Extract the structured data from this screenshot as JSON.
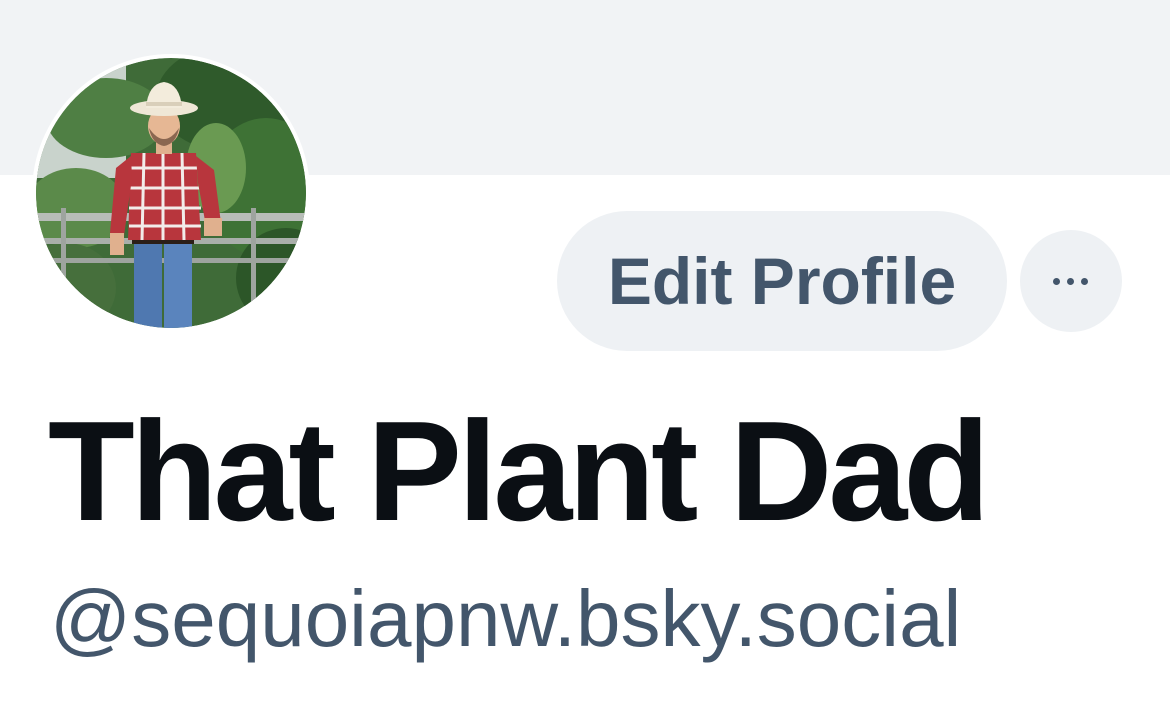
{
  "profile": {
    "display_name": "That Plant Dad",
    "handle": "@sequoiapnw.bsky.social",
    "avatar_icon": "profile-photo-man-in-cowboy-hat-plaid-shirt-with-plants"
  },
  "actions": {
    "edit_profile_label": "Edit Profile",
    "more_icon": "ellipsis-icon"
  },
  "colors": {
    "banner": "#f1f3f5",
    "button_bg": "#eef1f4",
    "button_text": "#43566b",
    "name_text": "#0b0f14",
    "handle_text": "#43566b"
  }
}
